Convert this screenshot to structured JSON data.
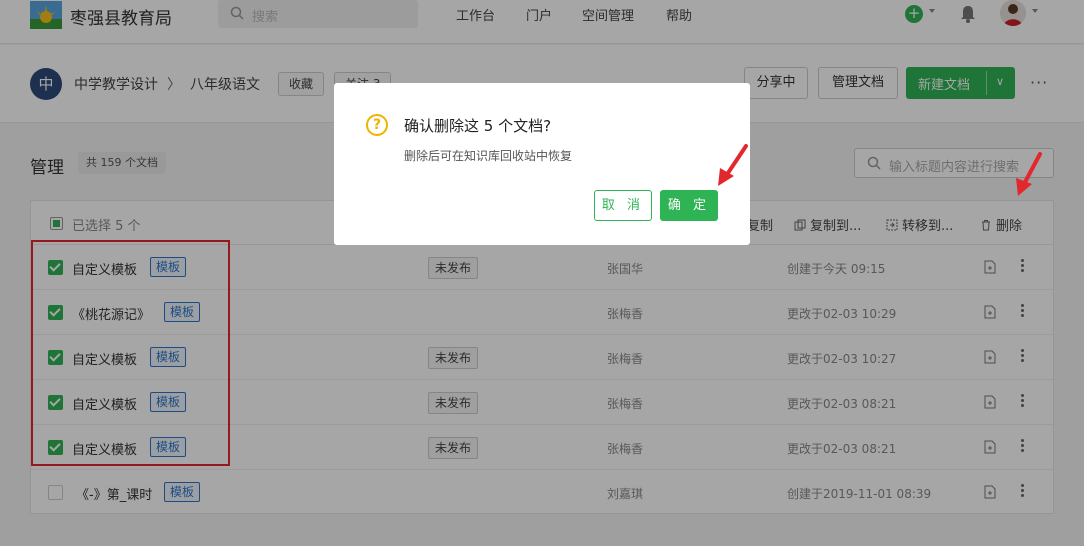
{
  "topbar": {
    "org_name": "枣强县教育局",
    "search_placeholder": "搜索",
    "nav": [
      "工作台",
      "门户",
      "空间管理",
      "帮助"
    ]
  },
  "header": {
    "book_avatar": "中",
    "breadcrumb": [
      "中学教学设计",
      "八年级语文"
    ],
    "favorite_label": "收藏",
    "follow_label": "关注 3",
    "sharing_label": "分享中",
    "manage_label": "管理文档",
    "new_doc_label": "新建文档"
  },
  "content": {
    "title": "管理",
    "count": "共 159 个文档",
    "search_placeholder": "输入标题内容进行搜索",
    "selected_text": "已选择 5 个",
    "bulk_actions": [
      "复制",
      "复制到...",
      "转移到...",
      "删除"
    ]
  },
  "rows": [
    {
      "title": "自定义模板",
      "tag": "模板",
      "status": "未发布",
      "author": "张国华",
      "time": "创建于今天 09:15",
      "checked": true
    },
    {
      "title": "《桃花源记》",
      "tag": "模板",
      "status": "",
      "author": "张梅香",
      "time": "更改于02-03 10:29",
      "checked": true
    },
    {
      "title": "自定义模板",
      "tag": "模板",
      "status": "未发布",
      "author": "张梅香",
      "time": "更改于02-03 10:27",
      "checked": true
    },
    {
      "title": "自定义模板",
      "tag": "模板",
      "status": "未发布",
      "author": "张梅香",
      "time": "更改于02-03 08:21",
      "checked": true
    },
    {
      "title": "自定义模板",
      "tag": "模板",
      "status": "未发布",
      "author": "张梅香",
      "time": "更改于02-03 08:21",
      "checked": true
    },
    {
      "title": "《-》第_课时",
      "tag": "模板",
      "status": "",
      "author": "刘嘉琪",
      "time": "创建于2019-11-01 08:39",
      "checked": false
    }
  ],
  "modal": {
    "title": "确认删除这 5 个文档?",
    "subtitle": "删除后可在知识库回收站中恢复",
    "cancel_label": "取 消",
    "ok_label": "确 定"
  },
  "colors": {
    "primary": "#2fb455",
    "tag_blue": "#2f76c8",
    "annotation_red": "#e2272d",
    "warning": "#f0b400"
  }
}
